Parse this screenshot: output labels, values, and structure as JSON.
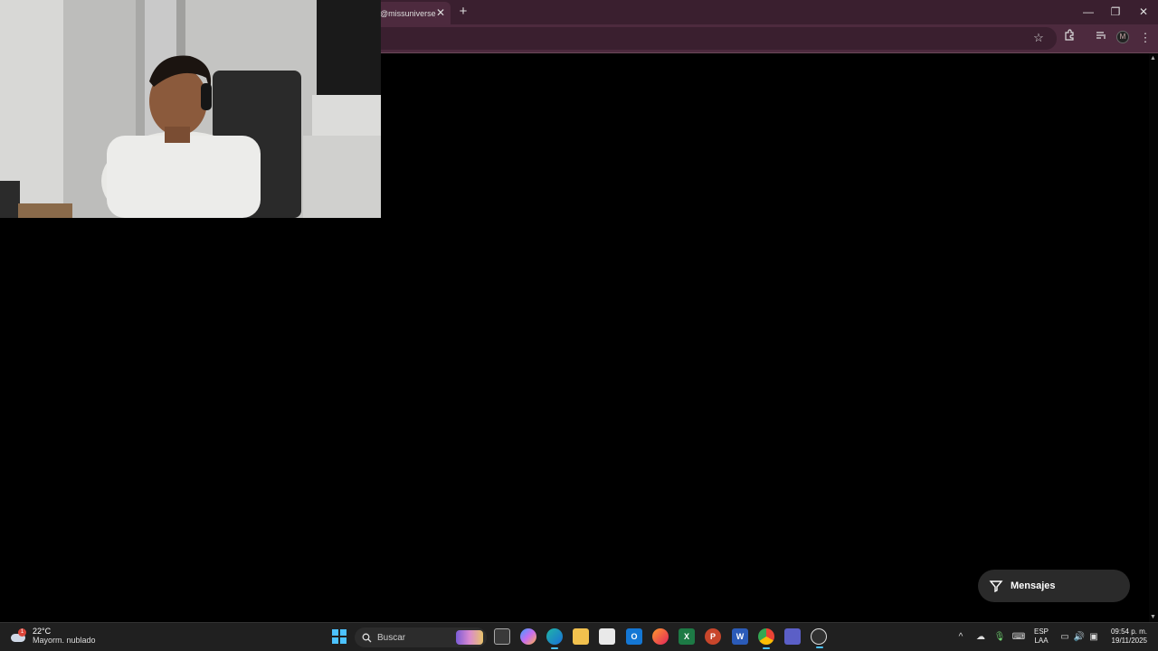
{
  "browser": {
    "tab_title": "@missuniverse)",
    "tab_close": "✕",
    "new_tab": "+",
    "window_controls": {
      "minimize": "—",
      "maximize": "❐",
      "close": "✕"
    },
    "toolbar_icons": [
      "star-icon",
      "extensions-icon",
      "media-control-icon",
      "profile-icon",
      "menu-icon"
    ],
    "profile_initial": "M",
    "accent_color": "#4d2a3e"
  },
  "page": {
    "messages_button": "Mensajes"
  },
  "taskbar": {
    "weather": {
      "temp": "22°C",
      "desc": "Mayorm. nublado",
      "badge": "1"
    },
    "search_placeholder": "Buscar",
    "apps": [
      {
        "name": "task-view",
        "label": ""
      },
      {
        "name": "copilot",
        "label": ""
      },
      {
        "name": "edge",
        "label": ""
      },
      {
        "name": "file-explorer",
        "label": ""
      },
      {
        "name": "microsoft-store",
        "label": ""
      },
      {
        "name": "outlook",
        "label": "O"
      },
      {
        "name": "firefox",
        "label": ""
      },
      {
        "name": "excel",
        "label": "X"
      },
      {
        "name": "powerpoint",
        "label": "P"
      },
      {
        "name": "word",
        "label": "W"
      },
      {
        "name": "chrome",
        "label": ""
      },
      {
        "name": "teams",
        "label": ""
      },
      {
        "name": "obs",
        "label": ""
      }
    ],
    "lang": {
      "line1": "ESP",
      "line2": "LAA"
    },
    "clock": {
      "time": "09:54 p. m.",
      "date": "19/11/2025"
    }
  }
}
